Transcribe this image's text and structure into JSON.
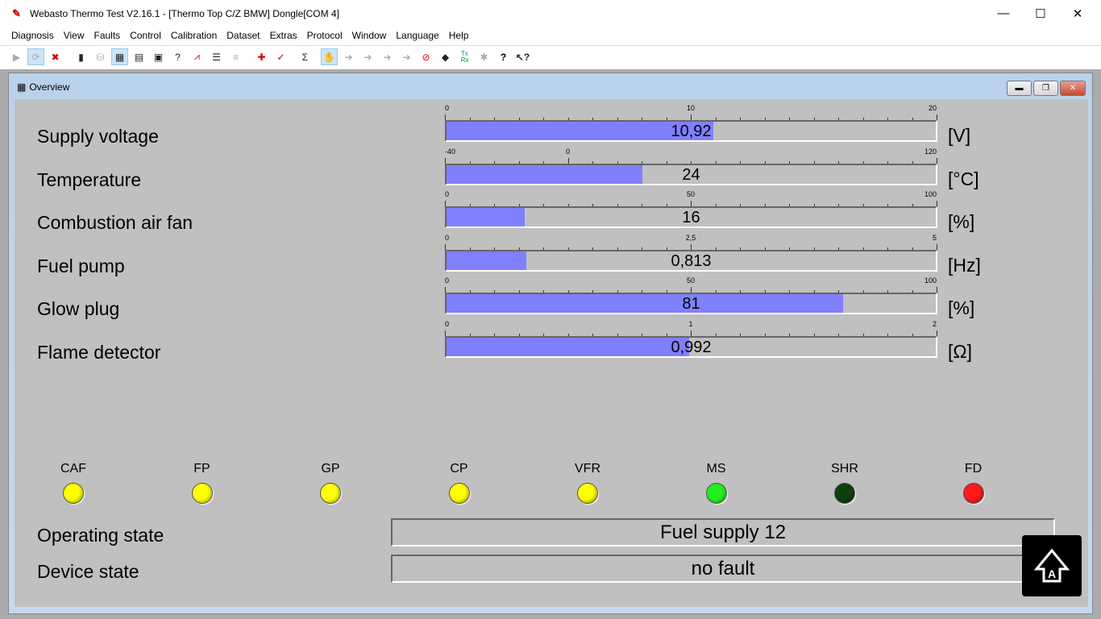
{
  "window": {
    "title": "Webasto Thermo Test V2.16.1 - [Thermo Top C/Z BMW] Dongle[COM 4]"
  },
  "menu": [
    "Diagnosis",
    "View",
    "Faults",
    "Control",
    "Calibration",
    "Dataset",
    "Extras",
    "Protocol",
    "Window",
    "Language",
    "Help"
  ],
  "toolbar": {
    "txrx_top": "Tx",
    "txrx_bottom": "Rx"
  },
  "child": {
    "title": "Overview"
  },
  "gauges": [
    {
      "label": "Supply voltage",
      "min_label": "0",
      "mid_label": "10",
      "max_label": "20",
      "value": "10,92",
      "unit": "[V]",
      "fraction": 0.546,
      "mid_pos": 0.5
    },
    {
      "label": "Temperature",
      "min_label": "-40",
      "mid_label": "0",
      "max_label": "120",
      "value": "24",
      "unit": "[°C]",
      "fraction": 0.4,
      "mid_pos": 0.25
    },
    {
      "label": "Combustion air fan",
      "min_label": "0",
      "mid_label": "50",
      "max_label": "100",
      "value": "16",
      "unit": "[%]",
      "fraction": 0.16,
      "mid_pos": 0.5
    },
    {
      "label": "Fuel pump",
      "min_label": "0",
      "mid_label": "2,5",
      "max_label": "5",
      "value": "0,813",
      "unit": "[Hz]",
      "fraction": 0.1626,
      "mid_pos": 0.5
    },
    {
      "label": "Glow plug",
      "min_label": "0",
      "mid_label": "50",
      "max_label": "100",
      "value": "81",
      "unit": "[%]",
      "fraction": 0.81,
      "mid_pos": 0.5
    },
    {
      "label": "Flame detector",
      "min_label": "0",
      "mid_label": "1",
      "max_label": "2",
      "value": "0,992",
      "unit": "[Ω]",
      "fraction": 0.496,
      "mid_pos": 0.5
    }
  ],
  "indicators": [
    {
      "label": "CAF",
      "color": "#ffff00"
    },
    {
      "label": "FP",
      "color": "#ffff00"
    },
    {
      "label": "GP",
      "color": "#ffff00"
    },
    {
      "label": "CP",
      "color": "#ffff00"
    },
    {
      "label": "VFR",
      "color": "#ffff00"
    },
    {
      "label": "MS",
      "color": "#22ee22"
    },
    {
      "label": "SHR",
      "color": "#0f3f0f"
    },
    {
      "label": "FD",
      "color": "#ff1a1a"
    }
  ],
  "operating_state": {
    "label": "Operating state",
    "value": "Fuel supply 12"
  },
  "device_state": {
    "label": "Device state",
    "value": "no fault"
  }
}
